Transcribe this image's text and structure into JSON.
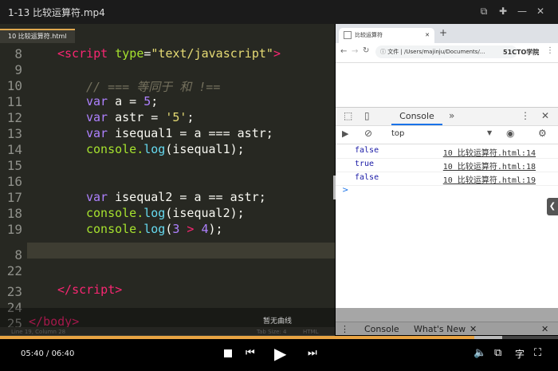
{
  "player": {
    "title": "1-13 比较运算符.mp4",
    "current_time": "05:40",
    "separator": " / ",
    "total_time": "06:40",
    "progress": 0.85,
    "buffered": 0.9,
    "subtitle_text": "暂无曲线",
    "caption_button": "字"
  },
  "editor": {
    "tab_label": "10 比较运算符.html",
    "status_left": "Line 19, Column 28",
    "status_tab": "Tab Size: 4",
    "status_syntax": "HTML",
    "line_numbers": [
      "8",
      "9",
      "10",
      "11",
      "12",
      "13",
      "14",
      "15",
      "16",
      "17",
      "18",
      "19",
      "8",
      "22",
      "23",
      "24",
      "25"
    ],
    "code": {
      "l8_open": "<",
      "l8_tag": "script",
      "l8_attr": "type",
      "l8_eq": "=",
      "l8_str": "\"text/javascript\"",
      "l8_close": ">",
      "l10_comment": "// === 等同于 和 !==",
      "var": "var",
      "l11_rest_a": " a = ",
      "l11_num": "5",
      "l11_semi": ";",
      "l12_rest": " astr = ",
      "l12_str": "'5'",
      "l12_semi": ";",
      "l13_rest": " isequal1 = a === astr;",
      "console": "console.",
      "log": "log",
      "l14_args": "(isequal1);",
      "l17_rest": " isequal2 = a == astr;",
      "l18_args": "(isequal2);",
      "l19_pre": "(",
      "l19_num1": "3",
      "l19_op": " > ",
      "l19_num2": "4",
      "l19_post": ");",
      "l23_open": "</",
      "l23_tag": "script",
      "l23_close": ">",
      "l25_open": "</",
      "l25_tag": "body",
      "l25_close": ">"
    }
  },
  "browser": {
    "tab_title": "比较运算符",
    "url_prefix": "文件",
    "url": "/Users/majinju/Documents/...",
    "watermark": "51CTO学院"
  },
  "devtools": {
    "console_tab": "Console",
    "more_tabs": "»",
    "context": "top",
    "logs": [
      {
        "value": "false",
        "source": "10 比较运算符.html:14"
      },
      {
        "value": "true",
        "source": "10 比较运算符.html:18"
      },
      {
        "value": "false",
        "source": "10 比较运算符.html:19"
      }
    ],
    "prompt": ">",
    "drawer_console": "Console",
    "drawer_whatsnew": "What's New"
  },
  "colors": {
    "progress_fill": "#e9a443",
    "accent_blue": "#1a73e8"
  }
}
